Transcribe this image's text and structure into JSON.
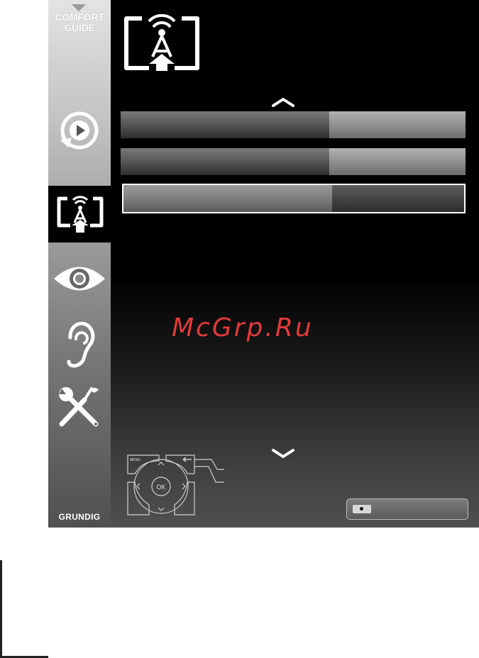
{
  "sidebar": {
    "comfort_guide": "COMFORT GUIDE",
    "brand": "GRUNDIG",
    "items": [
      {
        "name": "media-play-icon",
        "active": false
      },
      {
        "name": "network-settings-icon",
        "active": true
      },
      {
        "name": "picture-eye-icon",
        "active": false
      },
      {
        "name": "sound-ear-icon",
        "active": false
      },
      {
        "name": "settings-tools-icon",
        "active": false
      }
    ]
  },
  "header": {
    "icon": "network-settings-icon"
  },
  "menu": {
    "rows": [
      {
        "label": "",
        "value": "",
        "selected": false
      },
      {
        "label": "",
        "value": "",
        "selected": false
      },
      {
        "label": "",
        "value": "",
        "selected": true
      }
    ],
    "scroll_up_icon": "chevron-up-icon",
    "scroll_down_icon": "chevron-down-icon"
  },
  "watermark": "McGrp.Ru",
  "remote": {
    "ok_label": "OK",
    "menu_label": "MENU"
  },
  "legend": {
    "button_icon": "record-dot-icon",
    "label": ""
  },
  "colors": {
    "accent_watermark": "#e23a3a",
    "selected_border": "#ffffff",
    "background": "#000000"
  }
}
